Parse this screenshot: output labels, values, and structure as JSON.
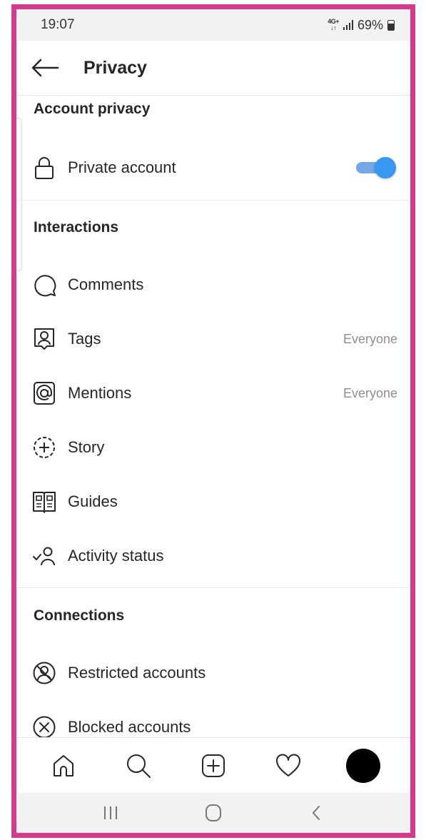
{
  "status_bar": {
    "time": "19:07",
    "network_top": "4G+",
    "network_bottom": "↓↑",
    "battery": "69%"
  },
  "header": {
    "title": "Privacy",
    "back_icon": "arrow-left-icon"
  },
  "sections": {
    "account_privacy": {
      "title": "Account privacy",
      "private_account": {
        "label": "Private account",
        "icon": "lock-icon",
        "enabled": true
      }
    },
    "interactions": {
      "title": "Interactions",
      "items": [
        {
          "label": "Comments",
          "icon": "comment-icon",
          "value": ""
        },
        {
          "label": "Tags",
          "icon": "tag-person-icon",
          "value": "Everyone"
        },
        {
          "label": "Mentions",
          "icon": "at-sign-icon",
          "value": "Everyone"
        },
        {
          "label": "Story",
          "icon": "story-add-icon",
          "value": ""
        },
        {
          "label": "Guides",
          "icon": "guide-book-icon",
          "value": ""
        },
        {
          "label": "Activity status",
          "icon": "activity-status-icon",
          "value": ""
        }
      ]
    },
    "connections": {
      "title": "Connections",
      "items": [
        {
          "label": "Restricted accounts",
          "icon": "restricted-icon"
        },
        {
          "label": "Blocked accounts",
          "icon": "blocked-icon"
        }
      ]
    }
  },
  "colors": {
    "accent": "#3897f0",
    "toggle_track": "#72a9e6",
    "frame": "#d63a8c",
    "secondary_text": "#8e8e8e"
  },
  "bottom_nav": [
    "home-icon",
    "search-icon",
    "new-post-icon",
    "activity-heart-icon",
    "profile-avatar"
  ],
  "system_nav": [
    "recent-apps-icon",
    "home-circle-icon",
    "back-chevron-icon"
  ]
}
